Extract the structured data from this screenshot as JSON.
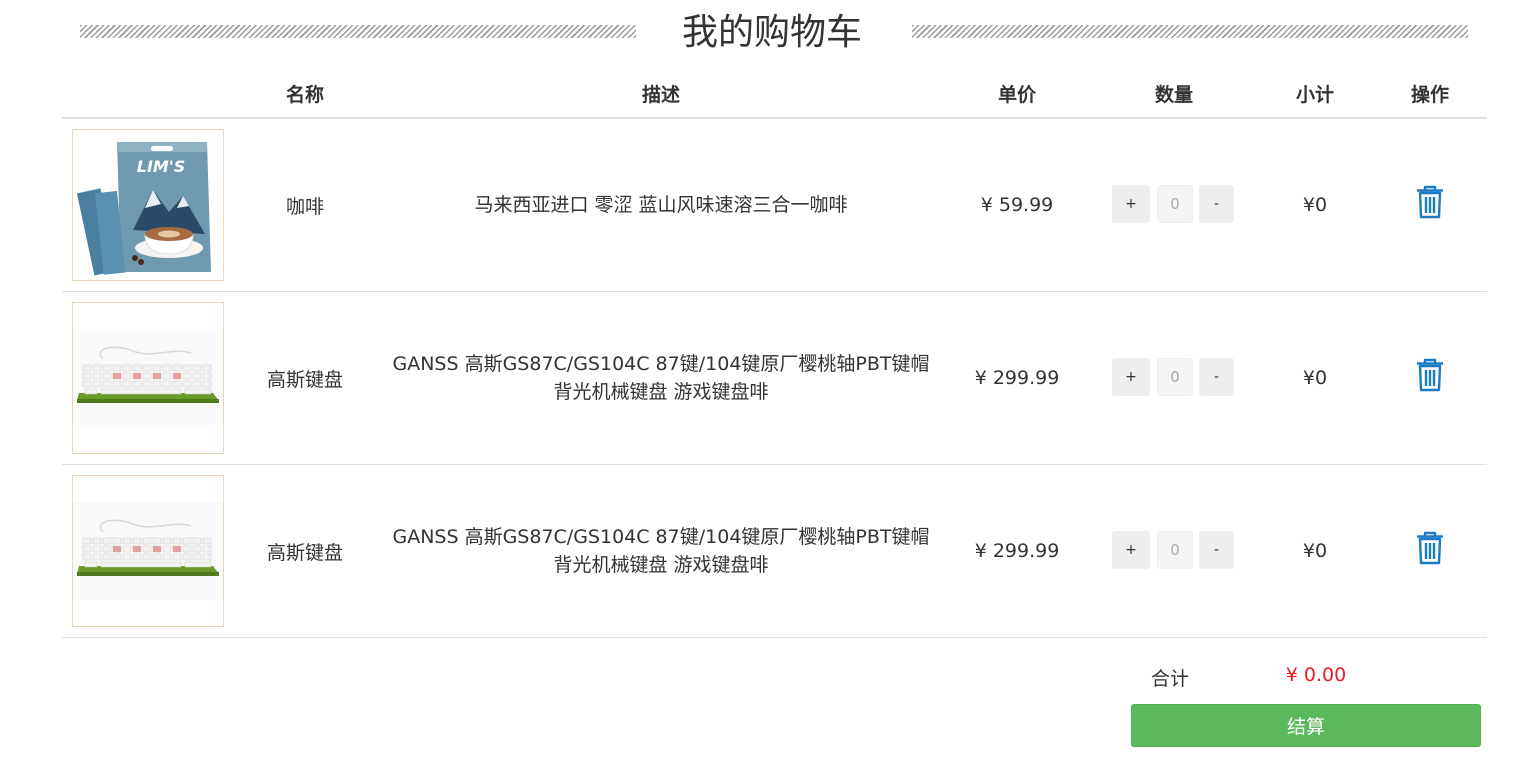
{
  "page": {
    "title": "我的购物车"
  },
  "table": {
    "headers": {
      "name": "名称",
      "desc": "描述",
      "price": "单价",
      "qty": "数量",
      "subtotal": "小计",
      "action": "操作"
    }
  },
  "items": [
    {
      "name": "咖啡",
      "desc": "马来西亚进口 零涩 蓝山风味速溶三合一咖啡",
      "price": "¥ 59.99",
      "qty_plus": "+",
      "qty_value": "0",
      "qty_minus": "-",
      "subtotal": "¥0",
      "image": "coffee-package",
      "image_text": "LIM'S"
    },
    {
      "name": "高斯键盘",
      "desc": "GANSS 高斯GS87C/GS104C 87键/104键原厂樱桃轴PBT键帽背光机械键盘 游戏键盘啡",
      "price": "¥ 299.99",
      "qty_plus": "+",
      "qty_value": "0",
      "qty_minus": "-",
      "subtotal": "¥0",
      "image": "keyboard"
    },
    {
      "name": "高斯键盘",
      "desc": "GANSS 高斯GS87C/GS104C 87键/104键原厂樱桃轴PBT键帽背光机械键盘 游戏键盘啡",
      "price": "¥ 299.99",
      "qty_plus": "+",
      "qty_value": "0",
      "qty_minus": "-",
      "subtotal": "¥0",
      "image": "keyboard"
    }
  ],
  "summary": {
    "total_label": "合计",
    "total_value": "¥ 0.00",
    "checkout_label": "结算"
  },
  "colors": {
    "accent_blue": "#1a7bc4",
    "price_red": "#e51c23",
    "checkout_green": "#5cb85c"
  },
  "icons": {
    "delete": "trash-icon"
  }
}
